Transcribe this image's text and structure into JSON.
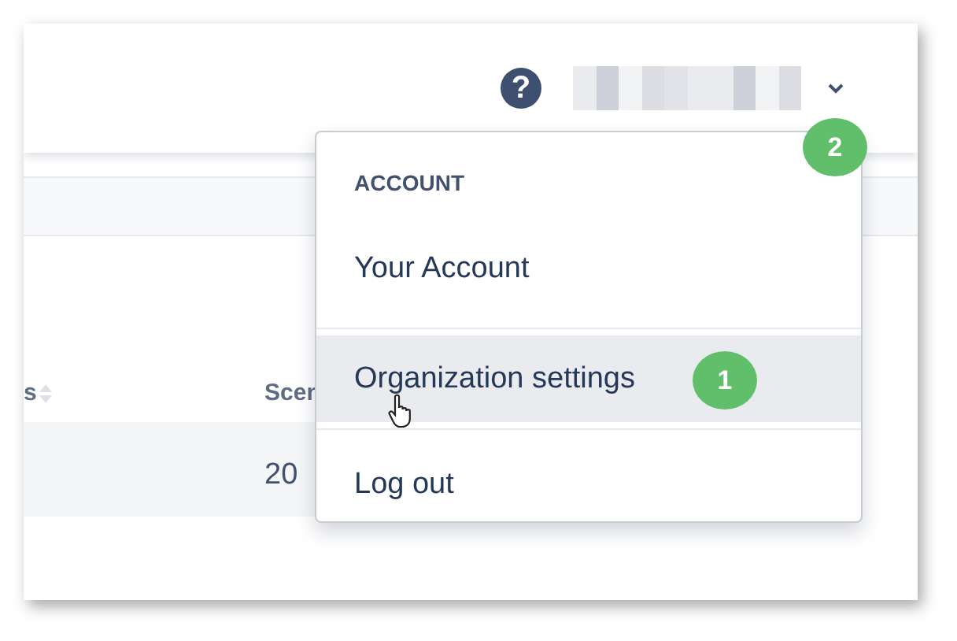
{
  "header": {
    "help_icon": "?",
    "account": {
      "expanded": true,
      "badge": "2"
    }
  },
  "table": {
    "columns": [
      "s",
      "Scen"
    ],
    "rows": [
      {
        "cells": [
          "",
          "20"
        ]
      }
    ]
  },
  "menu": {
    "heading": "ACCOUNT",
    "items": [
      {
        "label": "Your Account",
        "selected": false
      },
      {
        "label": "Organization settings",
        "selected": true,
        "badge": "1"
      },
      {
        "label": "Log out",
        "selected": false
      }
    ]
  }
}
